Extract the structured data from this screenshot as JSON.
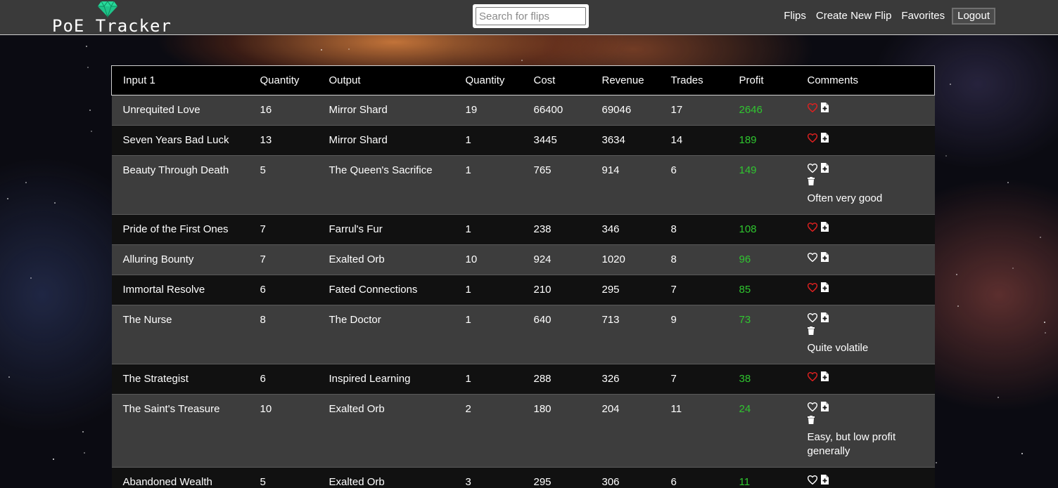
{
  "header": {
    "logo_text": "PoE Tracker",
    "search_placeholder": "Search for flips",
    "search_value": "",
    "nav": {
      "flips": "Flips",
      "create": "Create New Flip",
      "favorites": "Favorites",
      "logout": "Logout"
    }
  },
  "table": {
    "columns": [
      "Input 1",
      "Quantity",
      "Output",
      "Quantity",
      "Cost",
      "Revenue",
      "Trades",
      "Profit",
      "Comments"
    ],
    "rows": [
      {
        "input": "Unrequited Love",
        "qty_in": "16",
        "output": "Mirror Shard",
        "qty_out": "19",
        "cost": "66400",
        "revenue": "69046",
        "trades": "17",
        "profit": "2646",
        "favorite": true,
        "can_delete": false,
        "comment": ""
      },
      {
        "input": "Seven Years Bad Luck",
        "qty_in": "13",
        "output": "Mirror Shard",
        "qty_out": "1",
        "cost": "3445",
        "revenue": "3634",
        "trades": "14",
        "profit": "189",
        "favorite": true,
        "can_delete": false,
        "comment": ""
      },
      {
        "input": "Beauty Through Death",
        "qty_in": "5",
        "output": "The Queen's Sacrifice",
        "qty_out": "1",
        "cost": "765",
        "revenue": "914",
        "trades": "6",
        "profit": "149",
        "favorite": false,
        "can_delete": true,
        "comment": "Often very good"
      },
      {
        "input": "Pride of the First Ones",
        "qty_in": "7",
        "output": "Farrul's Fur",
        "qty_out": "1",
        "cost": "238",
        "revenue": "346",
        "trades": "8",
        "profit": "108",
        "favorite": true,
        "can_delete": false,
        "comment": ""
      },
      {
        "input": "Alluring Bounty",
        "qty_in": "7",
        "output": "Exalted Orb",
        "qty_out": "10",
        "cost": "924",
        "revenue": "1020",
        "trades": "8",
        "profit": "96",
        "favorite": false,
        "can_delete": false,
        "comment": ""
      },
      {
        "input": "Immortal Resolve",
        "qty_in": "6",
        "output": "Fated Connections",
        "qty_out": "1",
        "cost": "210",
        "revenue": "295",
        "trades": "7",
        "profit": "85",
        "favorite": true,
        "can_delete": false,
        "comment": ""
      },
      {
        "input": "The Nurse",
        "qty_in": "8",
        "output": "The Doctor",
        "qty_out": "1",
        "cost": "640",
        "revenue": "713",
        "trades": "9",
        "profit": "73",
        "favorite": false,
        "can_delete": true,
        "comment": "Quite volatile"
      },
      {
        "input": "The Strategist",
        "qty_in": "6",
        "output": "Inspired Learning",
        "qty_out": "1",
        "cost": "288",
        "revenue": "326",
        "trades": "7",
        "profit": "38",
        "favorite": true,
        "can_delete": false,
        "comment": ""
      },
      {
        "input": "The Saint's Treasure",
        "qty_in": "10",
        "output": "Exalted Orb",
        "qty_out": "2",
        "cost": "180",
        "revenue": "204",
        "trades": "11",
        "profit": "24",
        "favorite": false,
        "can_delete": true,
        "comment": "Easy, but low profit generally"
      },
      {
        "input": "Abandoned Wealth",
        "qty_in": "5",
        "output": "Exalted Orb",
        "qty_out": "3",
        "cost": "295",
        "revenue": "306",
        "trades": "6",
        "profit": "11",
        "favorite": false,
        "can_delete": false,
        "comment": ""
      }
    ]
  },
  "colors": {
    "header_bg": "#3a3a3a",
    "profit": "#2fc52f",
    "favorite": "#e02020",
    "logo_gem": "#1fc48a"
  }
}
